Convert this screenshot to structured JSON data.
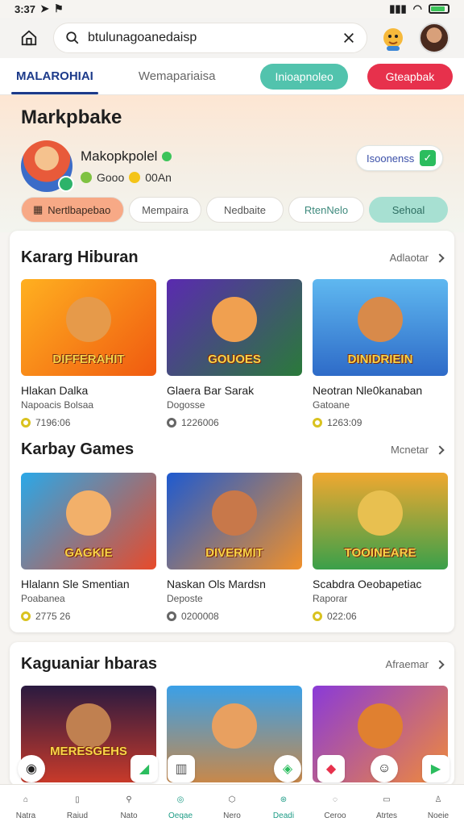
{
  "status": {
    "time": "3:37"
  },
  "search": {
    "value": "btulunagoanedaisp"
  },
  "tabs": {
    "active": "MALAROHIAI",
    "second": "Wemapariaisa",
    "btn_teal": "Inioapnoleo",
    "btn_red": "Gteapbak"
  },
  "hero": {
    "title": "Markpbake",
    "name": "Makopkpolel",
    "meta1": "Gooo",
    "meta2": "00An",
    "card_label": "Isoonenss",
    "chips": [
      "Nertlbapebao",
      "Mempaira",
      "Nedbaite",
      "RtenNelo",
      "Sehoal"
    ]
  },
  "section1": {
    "title": "Kararg Hiburan",
    "more": "Adlaotar",
    "games": [
      {
        "name": "Hlakan Dalka",
        "sub": "Napoacis Bolsaa",
        "count": "7196:06",
        "art": "DIFFERAHIT"
      },
      {
        "name": "Glaera Bar Sarak",
        "sub": "Dogosse",
        "count": "1226006",
        "art": "GOUOES"
      },
      {
        "name": "Neotran Nle0kanaban",
        "sub": "Gatoane",
        "count": "1263:09",
        "art": "DINIDRIEIN"
      }
    ]
  },
  "section2": {
    "title": "Karbay Games",
    "more": "Mcnetar",
    "games": [
      {
        "name": "Hlalann Sle Smentian",
        "sub": "Poabanea",
        "count": "2775 26",
        "art": "GAGKIE"
      },
      {
        "name": "Naskan Ols Mardsn",
        "sub": "Deposte",
        "count": "0200008",
        "art": "DIVERMIT"
      },
      {
        "name": "Scabdra Oeobapetiac",
        "sub": "Raporar",
        "count": "022:06",
        "art": "TOOINEARE"
      }
    ]
  },
  "section3": {
    "title": "Kaguaniar hbaras",
    "more": "Afraemar",
    "games": [
      {
        "art": "MERESGEHS"
      },
      {
        "art": ""
      },
      {
        "art": ""
      }
    ]
  },
  "nav": [
    "Natra",
    "Raiud",
    "Nato",
    "Oeqae",
    "Nero",
    "Deadi",
    "Ceroo",
    "Atrtes",
    "Noeie"
  ],
  "colors": {
    "accent": "#1e9c86",
    "brand": "#1c3a8a",
    "red": "#e7314c",
    "teal": "#52c3ad"
  }
}
